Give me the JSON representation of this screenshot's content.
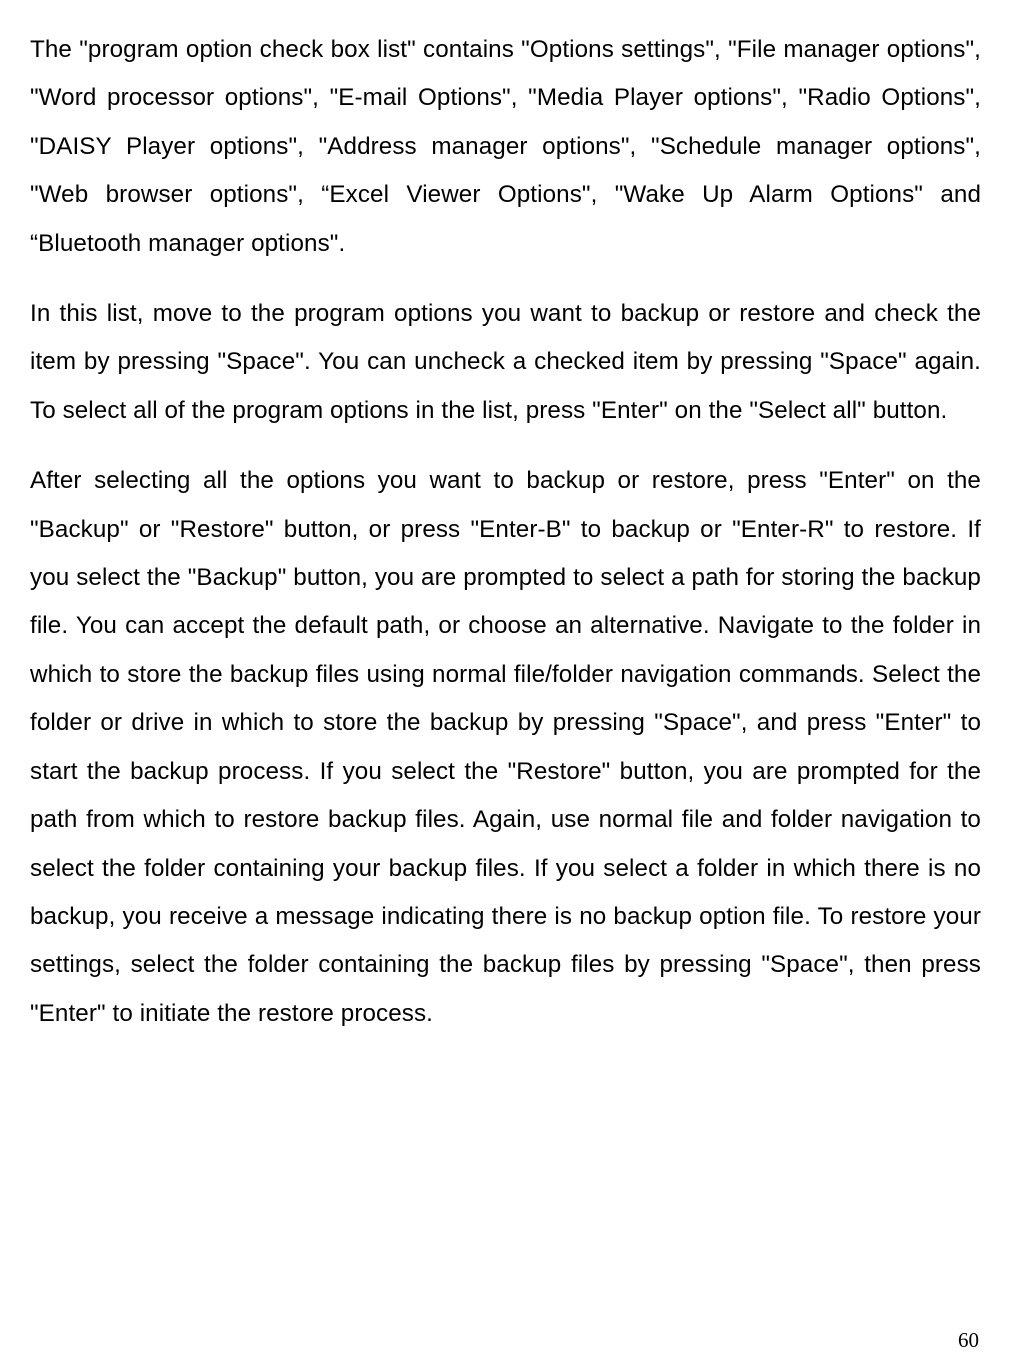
{
  "paragraphs": {
    "p1": "The \"program option check box list\" contains \"Options settings\", \"File manager options\", \"Word processor options\", \"E-mail Options\", \"Media Player options\", \"Radio Options\", \"DAISY Player options\", \"Address manager options\", \"Schedule manager options\", \"Web browser options\", “Excel Viewer Options\", \"Wake Up Alarm Options\" and “Bluetooth manager options\".",
    "p2": "In this list, move to the program options you want to backup or restore and check the item by pressing \"Space\". You can uncheck a checked item by pressing \"Space\" again. To select all of the program options in the list, press \"Enter\" on the \"Select all\" button.",
    "p3": "After selecting all the options you want to backup or restore, press \"Enter\" on the \"Backup\" or \"Restore\" button, or press \"Enter-B\" to backup or \"Enter-R\" to restore. If you select the \"Backup\" button, you are prompted to select a path for storing the backup file. You can accept the default path, or choose an alternative. Navigate to the folder in which to store the backup files using normal file/folder navigation commands. Select the folder or drive in which to store the backup by pressing \"Space\", and press \"Enter\" to start the backup process. If you select the \"Restore\" button, you are prompted for the path from which to restore backup files. Again, use normal file and folder navigation to select the folder containing your backup files. If you select a folder in which there is no backup, you receive a message indicating there is no backup option file. To restore your settings, select the folder containing the backup files by pressing \"Space\", then press \"Enter\" to initiate the restore process."
  },
  "page_number": "60"
}
